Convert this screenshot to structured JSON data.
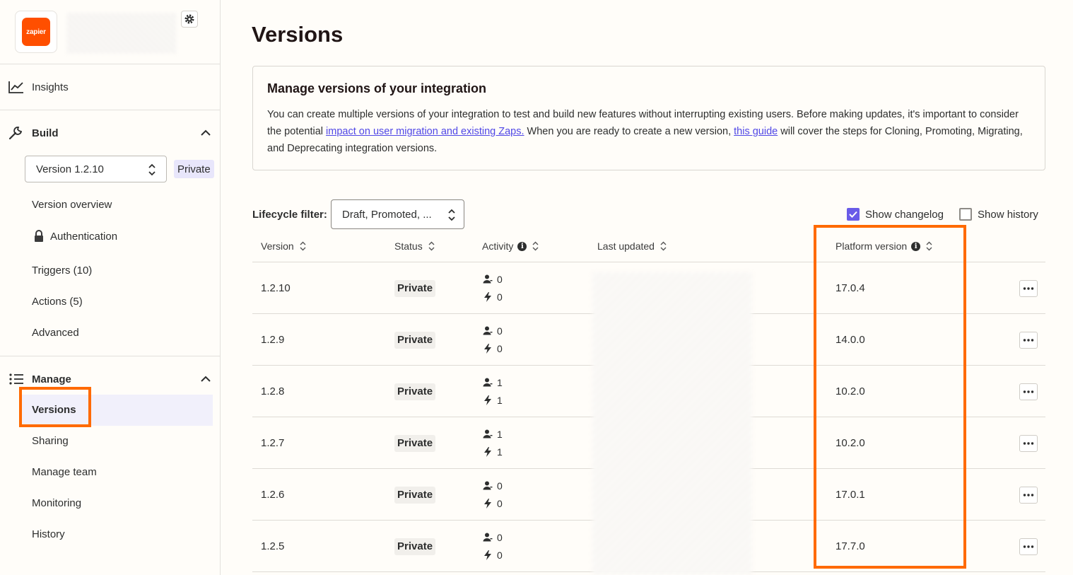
{
  "sidebar": {
    "logo_text": "zapier",
    "insights": "Insights",
    "build": "Build",
    "version_select": "Version 1.2.10",
    "private_badge": "Private",
    "version_overview": "Version overview",
    "authentication": "Authentication",
    "triggers": "Triggers (10)",
    "actions": "Actions (5)",
    "advanced": "Advanced",
    "manage": "Manage",
    "versions": "Versions",
    "sharing": "Sharing",
    "manage_team": "Manage team",
    "monitoring": "Monitoring",
    "history": "History"
  },
  "main": {
    "title": "Versions",
    "info_heading": "Manage versions of your integration",
    "info_text_1": "You can create multiple versions of your integration to test and build new features without interrupting existing users. Before making updates, it's important to consider the potential ",
    "info_link_1": "impact on user migration and existing Zaps.",
    "info_text_2": " When you are ready to create a new version, ",
    "info_link_2": "this guide",
    "info_text_3": " will cover the steps for Cloning, Promoting, Migrating, and Deprecating integration versions.",
    "filter_label": "Lifecycle filter:",
    "filter_value": "Draft, Promoted, ...",
    "show_changelog": "Show changelog",
    "show_history": "Show history",
    "columns": {
      "version": "Version",
      "status": "Status",
      "activity": "Activity",
      "last_updated": "Last updated",
      "platform_version": "Platform version"
    },
    "rows": [
      {
        "version": "1.2.10",
        "status": "Private",
        "users": "0",
        "zaps": "0",
        "platform": "17.0.4"
      },
      {
        "version": "1.2.9",
        "status": "Private",
        "users": "0",
        "zaps": "0",
        "platform": "14.0.0"
      },
      {
        "version": "1.2.8",
        "status": "Private",
        "users": "1",
        "zaps": "1",
        "platform": "10.2.0"
      },
      {
        "version": "1.2.7",
        "status": "Private",
        "users": "1",
        "zaps": "1",
        "platform": "10.2.0"
      },
      {
        "version": "1.2.6",
        "status": "Private",
        "users": "0",
        "zaps": "0",
        "platform": "17.0.1"
      },
      {
        "version": "1.2.5",
        "status": "Private",
        "users": "0",
        "zaps": "0",
        "platform": "17.7.0"
      }
    ]
  },
  "colors": {
    "accent": "#695be8",
    "highlight": "#ff6a00",
    "brand": "#ff4f00"
  }
}
